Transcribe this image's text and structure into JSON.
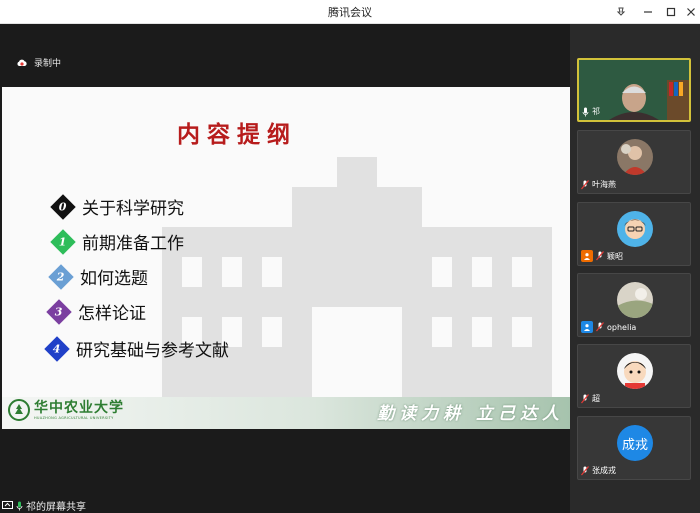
{
  "window": {
    "title": "腾讯会议"
  },
  "recording": {
    "label": "录制中"
  },
  "slide": {
    "title": "内容提纲",
    "items": [
      {
        "num": "0",
        "text": "关于科学研究",
        "color": "#111111"
      },
      {
        "num": "1",
        "text": "前期准备工作",
        "color": "#2ebd5a"
      },
      {
        "num": "2",
        "text": "如何选题",
        "color": "#6a9fd4"
      },
      {
        "num": "3",
        "text": "怎样论证",
        "color": "#7b3fa0"
      },
      {
        "num": "4",
        "text": "研究基础与参考文献",
        "color": "#2040c8"
      }
    ],
    "logo_cn": "华中农业大学",
    "logo_en": "HUAZHONG AGRICULTURAL UNIVERSITY",
    "motto": "勤读力耕 立己达人"
  },
  "share": {
    "label": "祁的屏幕共享"
  },
  "participants": [
    {
      "name": "祁"
    },
    {
      "name": "叶海燕"
    },
    {
      "name": "颖昭"
    },
    {
      "name": "ophelia"
    },
    {
      "name": "超"
    },
    {
      "name": "张成戎",
      "initials": "成戎"
    }
  ],
  "colors": {
    "accent": "#1e88e5",
    "active_border": "#d2c23a",
    "title_red": "#b71c1c",
    "campus_green": "#2e7d32"
  }
}
